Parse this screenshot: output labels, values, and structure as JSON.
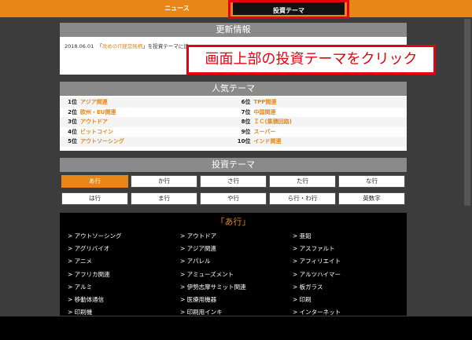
{
  "nav": {
    "news": "ニュース",
    "theme": "投資テーマ"
  },
  "update": {
    "header": "更新情報",
    "date": "2018.06.01",
    "bracket_open": "「",
    "link": "攻めのIT経営銘柄",
    "bracket_close": "」",
    "text": "を投資テーマに追"
  },
  "callout": "画面上部の投資テーマをクリック",
  "popular": {
    "header": "人気テーマ",
    "left": [
      {
        "rank": "1位",
        "name": "アジア関連"
      },
      {
        "rank": "2位",
        "name": "欧州・EU関連"
      },
      {
        "rank": "3位",
        "name": "アウトドア"
      },
      {
        "rank": "4位",
        "name": "ビットコイン"
      },
      {
        "rank": "5位",
        "name": "アウトソーシング"
      }
    ],
    "right": [
      {
        "rank": "6位",
        "name": "TPP関連"
      },
      {
        "rank": "7位",
        "name": "中国関連"
      },
      {
        "rank": "8位",
        "name": "ＩＣ(集積回路)"
      },
      {
        "rank": "9位",
        "name": "スーパー"
      },
      {
        "rank": "10位",
        "name": "インド関連"
      }
    ]
  },
  "theme": {
    "header": "投資テーマ",
    "rows_a": [
      "あ行",
      "か行",
      "さ行",
      "た行",
      "な行"
    ],
    "rows_b": [
      "は行",
      "ま行",
      "や行",
      "ら行・わ行",
      "英数字"
    ]
  },
  "list": {
    "title": "「あ行」",
    "items": [
      "> アウトソーシング",
      "> アウトドア",
      "> 亜鉛",
      "> アグリバイオ",
      "> アジア関連",
      "> アスファルト",
      "> アニメ",
      "> アパレル",
      "> アフィリエイト",
      "> アフリカ関連",
      "> アミューズメント",
      "> アルツハイマー",
      "> アルミ",
      "> 伊勢志摩サミット関連",
      "> 板ガラス",
      "> 移動体通信",
      "> 医療用機器",
      "> 印刷",
      "> 印刷機",
      "> 印刷用インキ",
      "> インターネット"
    ]
  },
  "colors": {
    "accent": "#e8861a",
    "highlight": "#e60012",
    "panel_head": "#8a8a8a"
  }
}
